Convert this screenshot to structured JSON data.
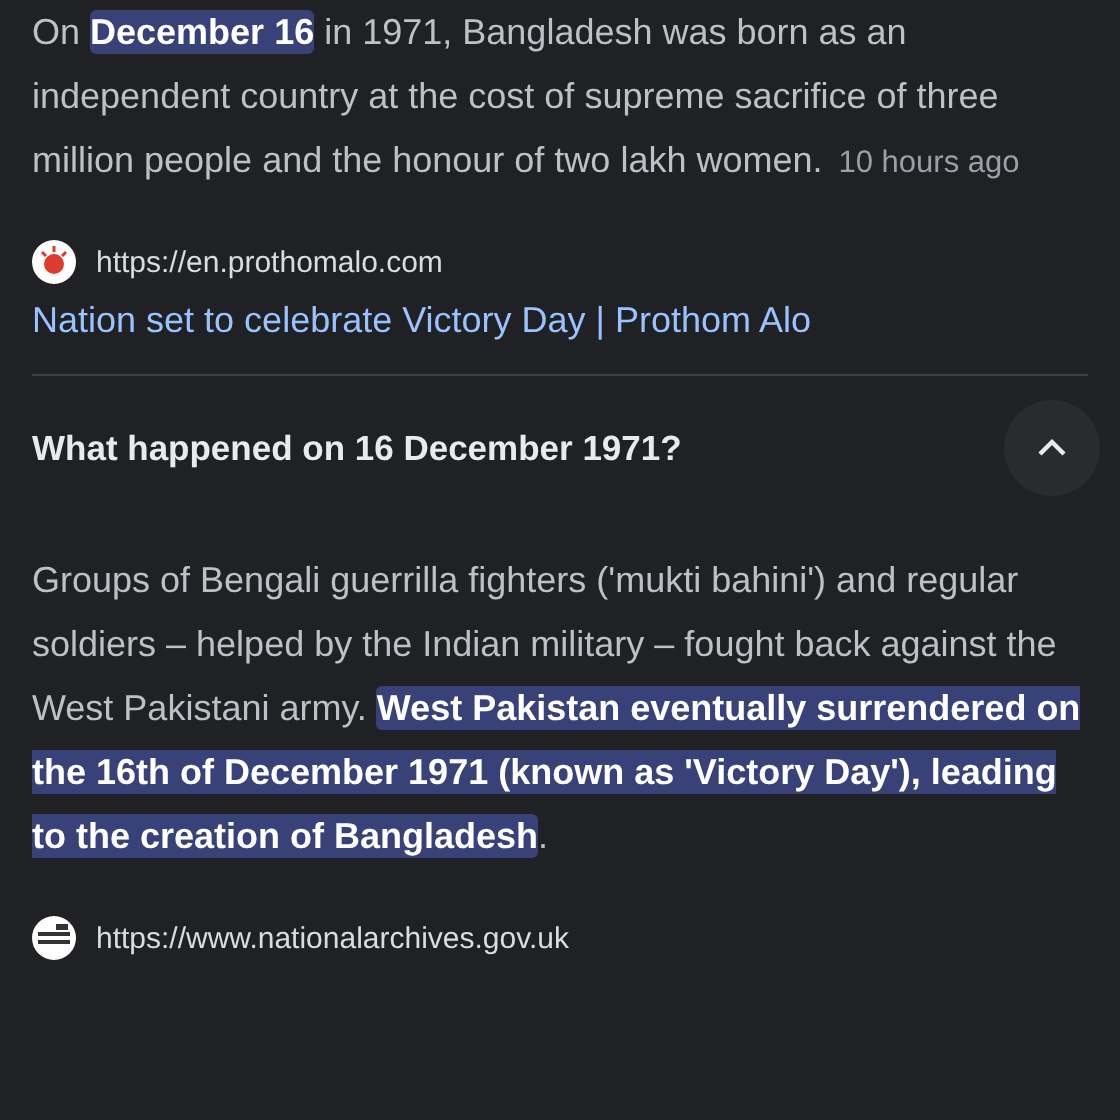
{
  "snippet": {
    "segments": [
      {
        "text": "On ",
        "highlighted": false
      },
      {
        "text": "December 16",
        "highlighted": true
      },
      {
        "text": " in 1971, Bangladesh was born as an independent country at the cost of supreme sacrifice of three million people and the honour of two lakh women.",
        "highlighted": false
      }
    ],
    "time": "10 hours ago"
  },
  "source": {
    "url": "https://en.prothomalo.com",
    "title": "Nation set to celebrate Victory Day | Prothom Alo"
  },
  "question": {
    "text": "What happened on 16 December 1971?",
    "expanded": true,
    "answer": [
      {
        "text": "Groups of Bengali guerrilla fighters ('mukti bahini') and regular soldiers – helped by the Indian military – fought back against the West Pakistani army. ",
        "highlighted": false
      },
      {
        "text": "West Pakistan eventually surrendered on the 16th of December 1971 (known as 'Victory Day'), leading to the creation of Bangladesh",
        "highlighted": true
      },
      {
        "text": ".",
        "highlighted": false
      }
    ],
    "source": {
      "url": "https://www.nationalarchives.gov.uk"
    }
  }
}
